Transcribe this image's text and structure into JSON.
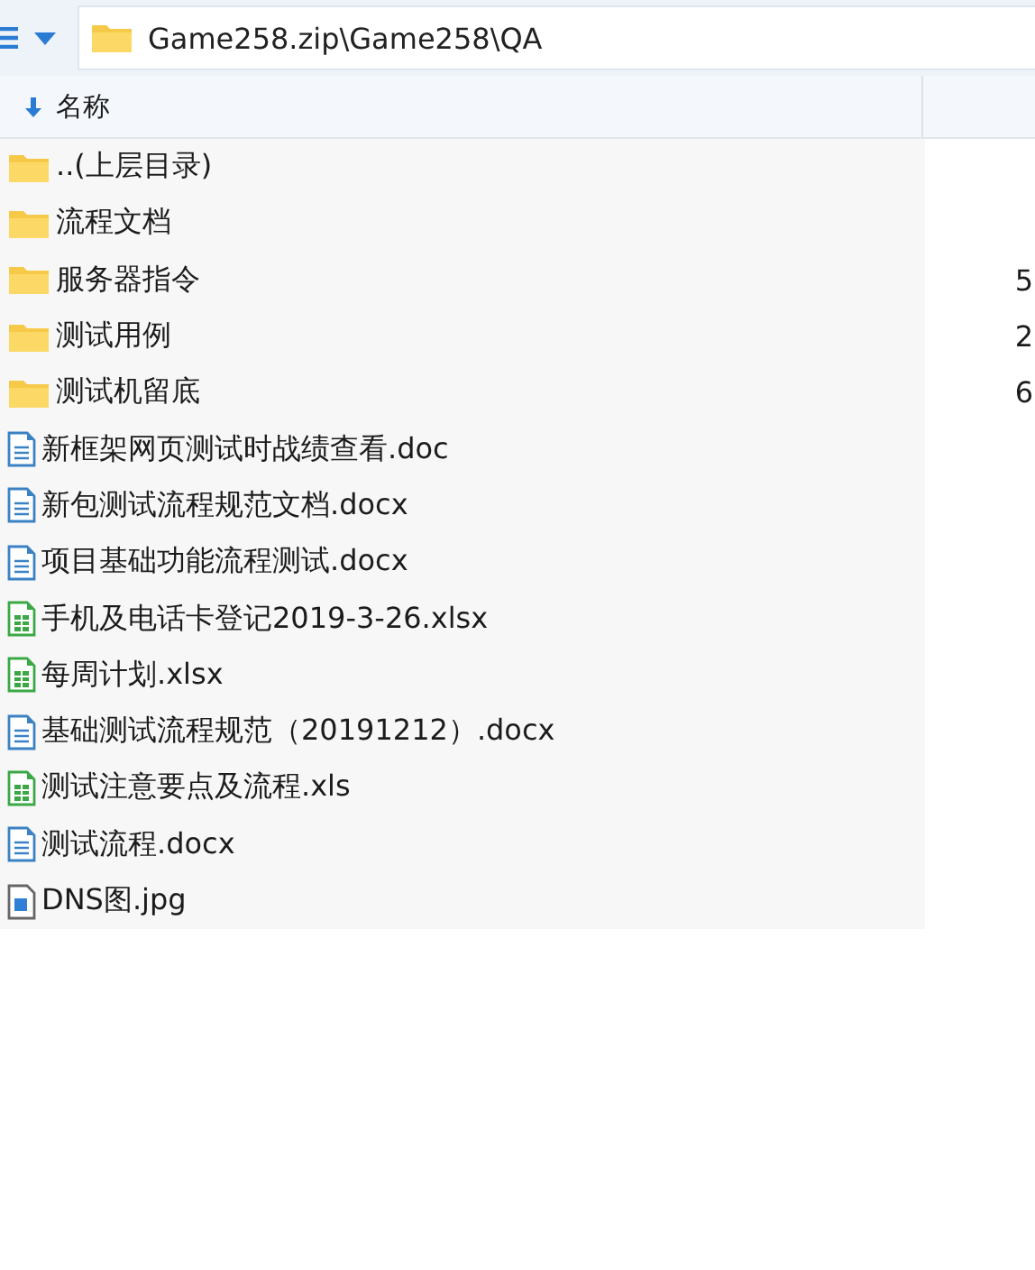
{
  "address_bar": {
    "path": "Game258.zip\\Game258\\QA"
  },
  "table": {
    "columns": [
      {
        "label": "名称",
        "sorted": true
      }
    ],
    "rows": [
      {
        "kind": "folder",
        "name": "..(上层目录)"
      },
      {
        "kind": "folder",
        "name": "流程文档"
      },
      {
        "kind": "folder",
        "name": "服务器指令",
        "column_2": "5"
      },
      {
        "kind": "folder",
        "name": "测试用例",
        "column_2": "2"
      },
      {
        "kind": "folder",
        "name": "测试机留底",
        "column_2": "6"
      },
      {
        "kind": "document",
        "name": "新框架网页测试时战绩查看.doc"
      },
      {
        "kind": "document",
        "name": "新包测试流程规范文档.docx"
      },
      {
        "kind": "document",
        "name": "项目基础功能流程测试.docx"
      },
      {
        "kind": "spreadsheet",
        "name": "手机及电话卡登记2019-3-26.xlsx"
      },
      {
        "kind": "spreadsheet",
        "name": "每周计划.xlsx"
      },
      {
        "kind": "document",
        "name": "基础测试流程规范（20191212）.docx"
      },
      {
        "kind": "spreadsheet",
        "name": "测试注意要点及流程.xls"
      },
      {
        "kind": "document",
        "name": "测试流程.docx"
      },
      {
        "kind": "image",
        "name": "DNS图.jpg"
      }
    ]
  }
}
